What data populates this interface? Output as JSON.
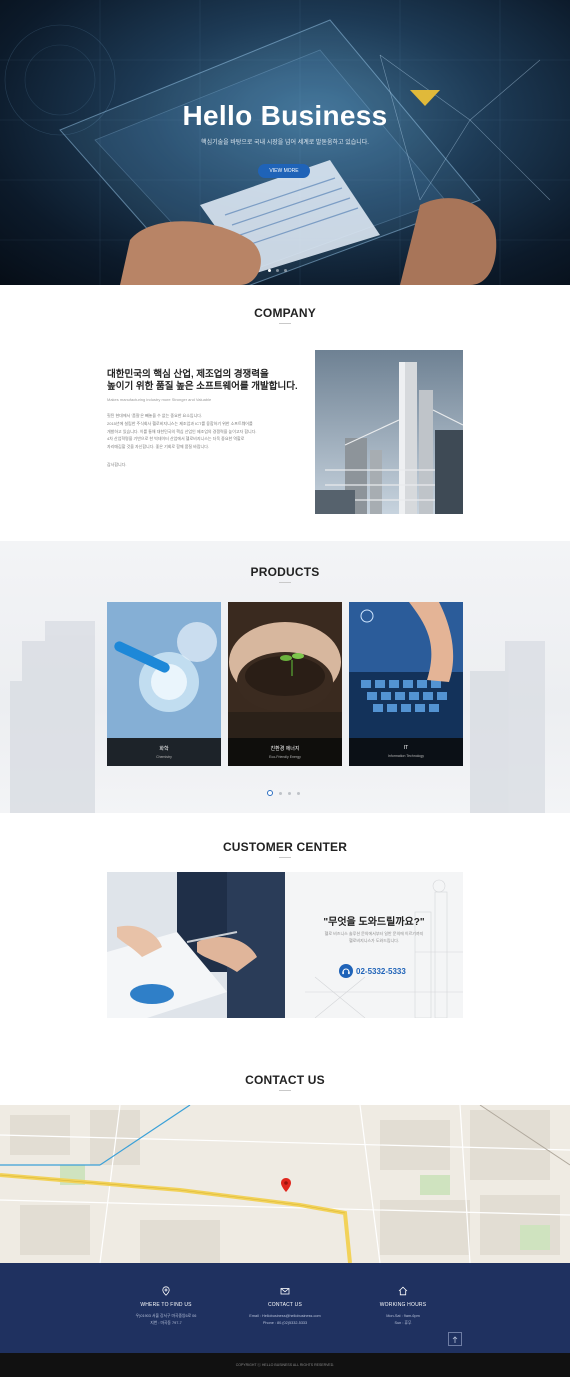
{
  "hero": {
    "title": "Hello Business",
    "subtitle": "핵심기술을 바탕으로 국내 시장을 넘어 세계로 발돋움하고 있습니다.",
    "button_label": "VIEW MORE",
    "slide_count": 3,
    "active_slide": 1
  },
  "company": {
    "title": "COMPANY",
    "headline_line1": "대한민국의 핵심 산업, 제조업의 경쟁력을",
    "headline_line2": "높이기 위한 품질 높은 소프트웨어를 개발합니다.",
    "subtitle_en": "Makes manufacturing industry more Stronger and Valuable",
    "body_lines": [
      "헛된 현대에서 '품질'은 빼놓을 수 없는 중요한 요소입니다.",
      "2015년에 설립한 주식회사 헬로비지니스는 제조업과 ICT를 융합하기 위한 소프트웨어를",
      "개발하고 있습니다. 이를 통해 대한민국의 핵심 산업인 제조업의 경쟁력을 높이고자 합니다.",
      "4차 산업혁명을 기반으로 한 빅데이터 산업에서 헬로비지니스는 더욱 중요한 역할로",
      "자리매김할 것을 자신합니다. 좋은 기회로 함께 품질 바랍니다."
    ],
    "thanks": "감사합니다."
  },
  "products": {
    "title": "PRODUCTS",
    "items": [
      {
        "name": "화학",
        "name_en": "Chemistry"
      },
      {
        "name": "친환경 에너지",
        "name_en": "Eco-Friendly Energy"
      },
      {
        "name": "IT",
        "name_en": "Information Technology"
      }
    ],
    "page_count": 4,
    "active_page": 1
  },
  "customer_center": {
    "title": "CUSTOMER CENTER",
    "question": "\"무엇을 도와드릴까요?\"",
    "desc_line1": "헬로 비즈니스 솔루션 문의에서부터 일반 문의에 이르기까지",
    "desc_line2": "헬로비지니스가 도와드립니다.",
    "phone": "02-5332-5333"
  },
  "contact": {
    "title": "CONTACT US"
  },
  "footer": {
    "where": {
      "heading": "WHERE TO FIND US",
      "line1": "우)01903 서울 강서구 마곡중앙6로 06",
      "line2": "지번 : 마곡동 797-7"
    },
    "contact": {
      "heading": "CONTACT US",
      "line1": "Email : Hellobusiness@hellobusiness.com",
      "line2": "Phone : 80.(02)5332-5333"
    },
    "hours": {
      "heading": "WORKING HOURS",
      "line1": "Mon-Sat : 9am-6pm",
      "line2": "Sun : 휴무"
    },
    "copyright": "COPYRIGHT ⓒ HELLO BUSINESS ALL RIGHTS RESERVED."
  },
  "colors": {
    "accent": "#1f63b8",
    "footer_bg": "#1f3160",
    "copyright_bg": "#111111"
  }
}
